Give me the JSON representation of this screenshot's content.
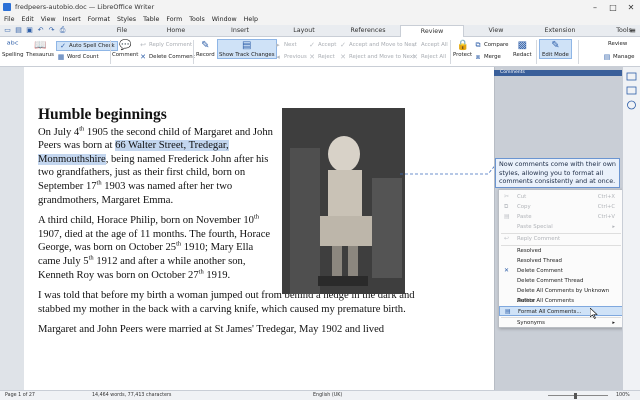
{
  "window": {
    "title": "fredpeers-autobio.doc — LibreOffice Writer",
    "controls": [
      "–",
      "□",
      "✕"
    ]
  },
  "menu": [
    "File",
    "Edit",
    "View",
    "Insert",
    "Format",
    "Styles",
    "Table",
    "Form",
    "Tools",
    "Window",
    "Help"
  ],
  "tabs": [
    "File",
    "Home",
    "Insert",
    "Layout",
    "References",
    "Review",
    "View",
    "Extension",
    "Tools"
  ],
  "active_tab": "Review",
  "ribbon": {
    "spelling": "Spelling",
    "thesaurus": "Thesaurus",
    "auto_spell": "Auto Spell Check",
    "word_count": "Word Count",
    "comment": "Comment",
    "reply_comment": "Reply Comment",
    "delete_comment": "Delete Comment",
    "record": "Record",
    "show_track_changes": "Show Track Changes",
    "next": "Next",
    "previous": "Previous",
    "accept": "Accept",
    "reject": "Reject",
    "accept_move_next": "Accept and Move to Next",
    "reject_move_next": "Reject and Move to Next",
    "accept_all": "Accept All",
    "reject_all": "Reject All",
    "protect": "Protect",
    "compare": "Compare",
    "merge": "Merge",
    "redact": "Redact",
    "edit_mode": "Edit Mode",
    "review": "Review",
    "manage": "Manage"
  },
  "document": {
    "heading": "Humble beginnings",
    "p1_a": "On July 4",
    "p1_sup1": "th",
    "p1_b": " 1905 the second child of Margaret and John Peers was born at ",
    "p1_sel": "66 Walter Street, Tredegar, Monmouthshire",
    "p1_c": ", being named Frederick John after his two grandfathers, just as their first child, born on September 17",
    "p1_sup2": "th",
    "p1_d": " 1903 was named after her two grandmothers, Margaret Emma.",
    "p2_a": "A third child, Horace Philip, born on November 10",
    "p2_sup1": "th",
    "p2_b": " 1907, died at the age of 11 months. The fourth, Horace George, was born on October 25",
    "p2_sup2": "th",
    "p2_c": " 1910; Mary Ella came July 5",
    "p2_sup3": "th",
    "p2_d": " 1912 and after a while another son, Kenneth Roy was born on October 27",
    "p2_sup4": "th",
    "p2_e": " 1919.",
    "p3": "I was told that before my birth a woman jumped out from behind a hedge in the dark and stabbed my mother in the back with a carving knife, which caused my premature birth.",
    "p4": "Margaret and John Peers were married at St James' Tredegar, May 1902 and lived"
  },
  "comments": {
    "header": "Comments",
    "note": "Now comments come with their own styles, allowing you to format all comments consistently and at once."
  },
  "context_menu": {
    "cut": "Cut",
    "cut_sc": "Ctrl+X",
    "copy": "Copy",
    "copy_sc": "Ctrl+C",
    "paste": "Paste",
    "paste_sc": "Ctrl+V",
    "paste_special": "Paste Special",
    "reply": "Reply Comment",
    "resolved": "Resolved",
    "resolved_thread": "Resolved Thread",
    "delete_comment": "Delete Comment",
    "delete_thread": "Delete Comment Thread",
    "delete_by_author": "Delete All Comments by Unknown Author",
    "delete_all": "Delete All Comments",
    "format_all": "Format All Comments...",
    "synonyms": "Synonyms"
  },
  "status": {
    "page": "Page 1 of 27",
    "words": "14,464 words, 77,413 characters",
    "language": "English (UK)",
    "zoom": "100%"
  }
}
